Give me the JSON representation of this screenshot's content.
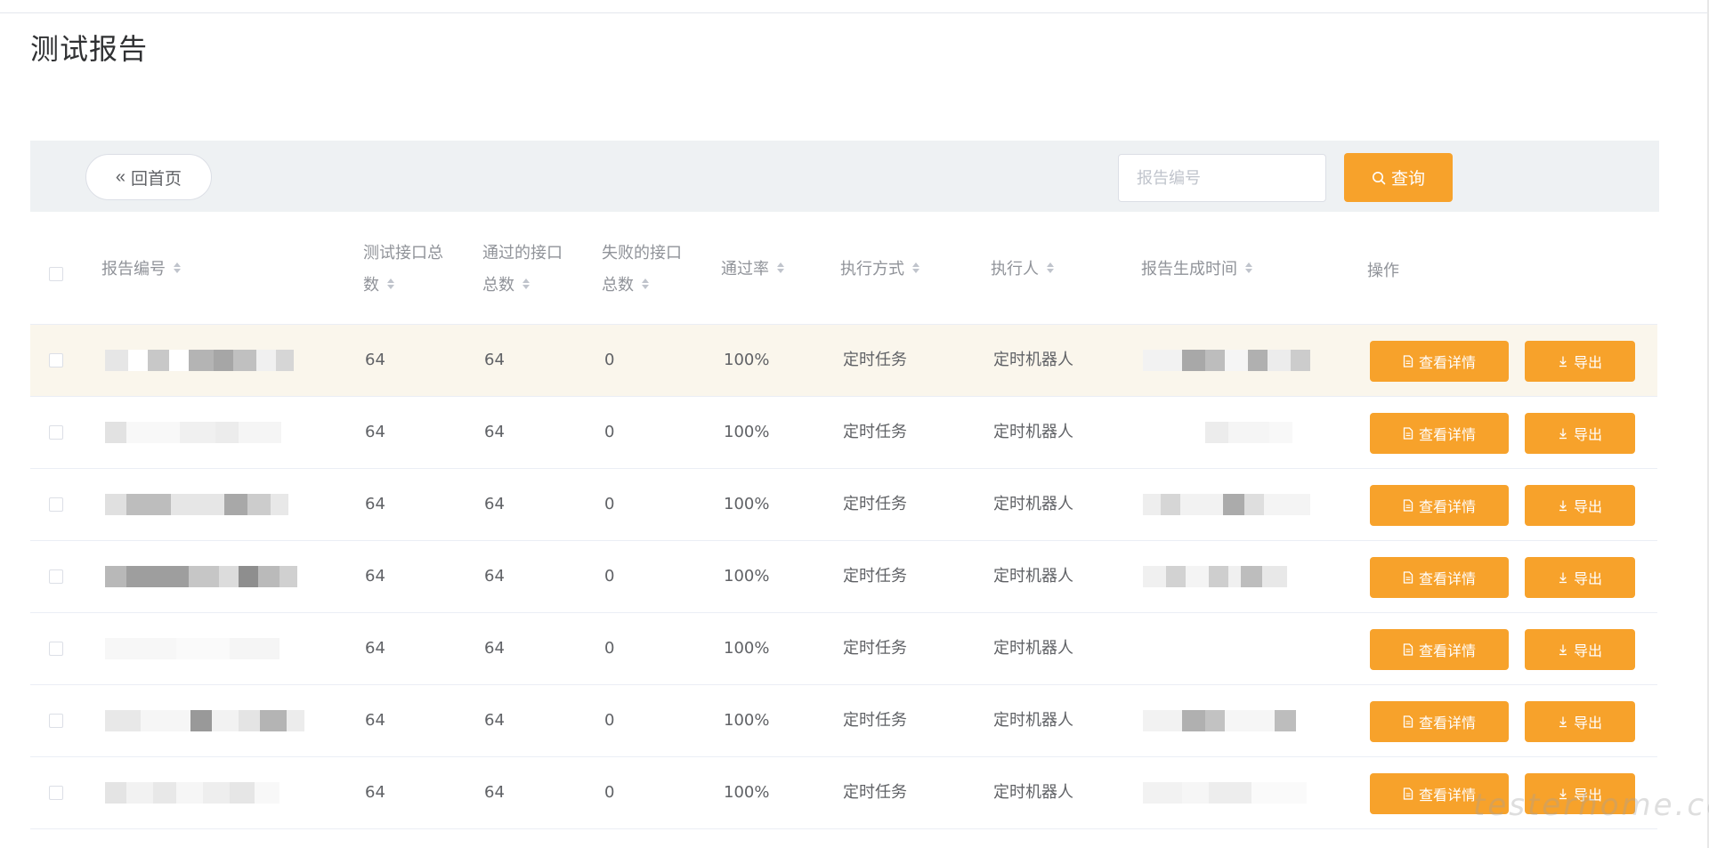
{
  "page": {
    "title": "测试报告"
  },
  "toolbar": {
    "back_label": "回首页",
    "search_placeholder": "报告编号",
    "query_label": "查询"
  },
  "table": {
    "columns": {
      "report_id": "报告编号",
      "total_line1": "测试接口总",
      "total_line2": "数",
      "passed_line1": "通过的接口",
      "passed_line2": "总数",
      "failed_line1": "失败的接口",
      "failed_line2": "总数",
      "pass_rate": "通过率",
      "exec_mode": "执行方式",
      "executor": "执行人",
      "generated_time": "报告生成时间",
      "actions": "操作"
    },
    "rows": [
      {
        "total": "64",
        "passed": "64",
        "failed": "0",
        "rate": "100%",
        "mode": "定时任务",
        "executor": "定时机器人",
        "detail_label": "查看详情",
        "export_label": "导出"
      },
      {
        "total": "64",
        "passed": "64",
        "failed": "0",
        "rate": "100%",
        "mode": "定时任务",
        "executor": "定时机器人",
        "detail_label": "查看详情",
        "export_label": "导出"
      },
      {
        "total": "64",
        "passed": "64",
        "failed": "0",
        "rate": "100%",
        "mode": "定时任务",
        "executor": "定时机器人",
        "detail_label": "查看详情",
        "export_label": "导出"
      },
      {
        "total": "64",
        "passed": "64",
        "failed": "0",
        "rate": "100%",
        "mode": "定时任务",
        "executor": "定时机器人",
        "detail_label": "查看详情",
        "export_label": "导出"
      },
      {
        "total": "64",
        "passed": "64",
        "failed": "0",
        "rate": "100%",
        "mode": "定时任务",
        "executor": "定时机器人",
        "detail_label": "查看详情",
        "export_label": "导出"
      },
      {
        "total": "64",
        "passed": "64",
        "failed": "0",
        "rate": "100%",
        "mode": "定时任务",
        "executor": "定时机器人",
        "detail_label": "查看详情",
        "export_label": "导出"
      },
      {
        "total": "64",
        "passed": "64",
        "failed": "0",
        "rate": "100%",
        "mode": "定时任务",
        "executor": "定时机器人",
        "detail_label": "查看详情",
        "export_label": "导出"
      }
    ]
  },
  "watermark": "testerhome.com",
  "colors": {
    "accent": "#f7a22b",
    "toolbar_bg": "#eef1f3",
    "highlight_row": "#faf6ec"
  }
}
